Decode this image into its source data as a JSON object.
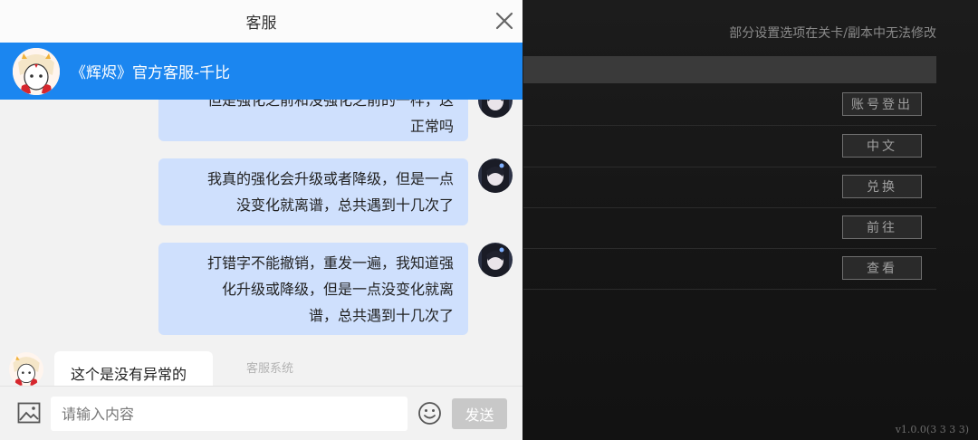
{
  "game_settings": {
    "notice": "部分设置选项在关卡/副本中无法修改",
    "buttons": [
      {
        "label": "账号登出"
      },
      {
        "label": "中文"
      },
      {
        "label": "兑换"
      },
      {
        "label": "前往"
      },
      {
        "label": "查看"
      }
    ],
    "version": "v1.0.0(3 3 3 3)"
  },
  "chat": {
    "title": "客服",
    "agent_name": "《辉烬》官方客服-千比",
    "messages": [
      {
        "from": "user",
        "lines": [
          "但是强化之前和没强化之前的一样，这",
          "正常吗"
        ]
      },
      {
        "from": "user",
        "lines": [
          "我真的强化会升级或者降级，但是一点",
          "没变化就离谱，总共遇到十几次了"
        ]
      },
      {
        "from": "user",
        "lines": [
          "打错字不能撤销，重发一遍，我知道强",
          "化升级或降级，但是一点没变化就离",
          "谱，总共遇到十几次了"
        ]
      },
      {
        "from": "agent",
        "text": "这个是没有异常的"
      }
    ],
    "system_label": "客服系统",
    "input_placeholder": "请输入内容",
    "send_label": "发送"
  },
  "colors": {
    "agent_header": "#1b86f0",
    "user_bubble": "#cfe0fd",
    "agent_bubble": "#ffffff",
    "send_button_disabled": "#c8c8c8",
    "game_background": "#141414"
  },
  "icons": {
    "close": "close-icon",
    "image": "image-icon",
    "emoji": "emoji-icon"
  }
}
